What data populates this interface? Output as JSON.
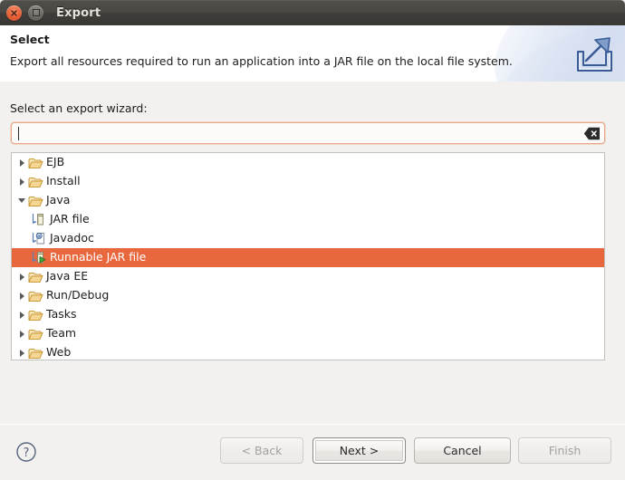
{
  "window": {
    "title": "Export",
    "close_label": "×",
    "maximize_label": "▫"
  },
  "header": {
    "title": "Select",
    "description": "Export all resources required to run an application into a JAR file on the local file system.",
    "icon": "export-wizard-icon"
  },
  "form": {
    "field_label": "Select an export wizard:",
    "search_value": "",
    "search_placeholder": "",
    "clear_icon": "clear-backspace-icon"
  },
  "tree": {
    "items": [
      {
        "label": "EJB",
        "icon": "folder-icon",
        "level": 0,
        "expanded": false,
        "selected": false,
        "has_twisty": true
      },
      {
        "label": "Install",
        "icon": "folder-icon",
        "level": 0,
        "expanded": false,
        "selected": false,
        "has_twisty": true
      },
      {
        "label": "Java",
        "icon": "folder-icon",
        "level": 0,
        "expanded": true,
        "selected": false,
        "has_twisty": true
      },
      {
        "label": "JAR file",
        "icon": "jar-file-icon",
        "level": 1,
        "expanded": false,
        "selected": false,
        "has_twisty": false
      },
      {
        "label": "Javadoc",
        "icon": "javadoc-icon",
        "level": 1,
        "expanded": false,
        "selected": false,
        "has_twisty": false
      },
      {
        "label": "Runnable JAR file",
        "icon": "runnable-jar-icon",
        "level": 1,
        "expanded": false,
        "selected": true,
        "has_twisty": false
      },
      {
        "label": "Java EE",
        "icon": "folder-icon",
        "level": 0,
        "expanded": false,
        "selected": false,
        "has_twisty": true
      },
      {
        "label": "Run/Debug",
        "icon": "folder-icon",
        "level": 0,
        "expanded": false,
        "selected": false,
        "has_twisty": true
      },
      {
        "label": "Tasks",
        "icon": "folder-icon",
        "level": 0,
        "expanded": false,
        "selected": false,
        "has_twisty": true
      },
      {
        "label": "Team",
        "icon": "folder-icon",
        "level": 0,
        "expanded": false,
        "selected": false,
        "has_twisty": true
      },
      {
        "label": "Web",
        "icon": "folder-icon",
        "level": 0,
        "expanded": false,
        "selected": false,
        "has_twisty": true
      }
    ]
  },
  "footer": {
    "help_icon": "help-question-icon",
    "buttons": [
      {
        "label": "< Back",
        "disabled": true,
        "focused": false
      },
      {
        "label": "Next >",
        "disabled": false,
        "focused": true
      },
      {
        "label": "Cancel",
        "disabled": false,
        "focused": false
      },
      {
        "label": "Finish",
        "disabled": true,
        "focused": false
      }
    ]
  },
  "colors": {
    "selection": "#e8673c",
    "titlebar": "#45433f",
    "focus_border": "#e8a487",
    "folder": "#e8b75c"
  }
}
